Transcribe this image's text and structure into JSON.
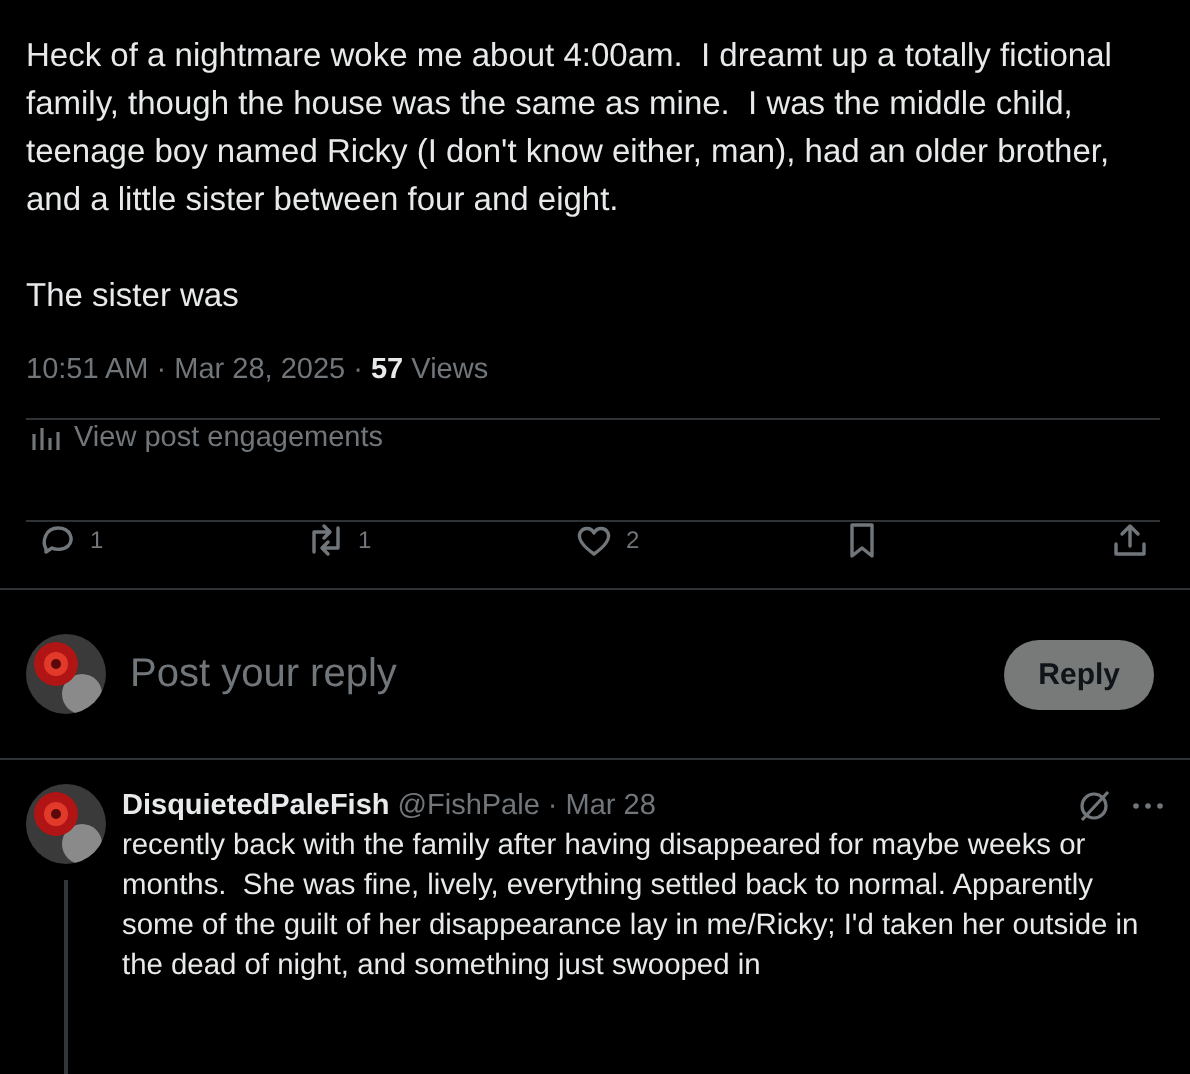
{
  "post": {
    "paragraphs": [
      "Heck of a nightmare woke me about 4:00am.  I dreamt up a totally fictional family, though the house was the same as mine.  I was the middle child, teenage boy named Ricky (I don't know either, man), had an older brother, and a little sister between four and eight.",
      "The sister was"
    ],
    "meta": "10:51 AM · Mar 28, 2025 · **57** Views",
    "engagements_link": "View post engagements",
    "actions": [
      {
        "kind": "reply",
        "count": "1"
      },
      {
        "kind": "repost",
        "count": "1"
      },
      {
        "kind": "like",
        "count": "2"
      },
      {
        "kind": "bookmark"
      },
      {
        "kind": "share"
      }
    ]
  },
  "composer": {
    "placeholder": "Post your reply",
    "button": "Reply"
  },
  "reply": {
    "name": "DisquietedPaleFish",
    "handle": "@FishPale",
    "date": "· Mar 28",
    "text": "recently back with the family after having disappeared for maybe weeks or months.  She was fine, lively, everything settled back to normal. Apparently some of the guilt of her disappearance lay in me/Ricky; I'd taken her outside in the dead of night, and something just swooped in"
  }
}
